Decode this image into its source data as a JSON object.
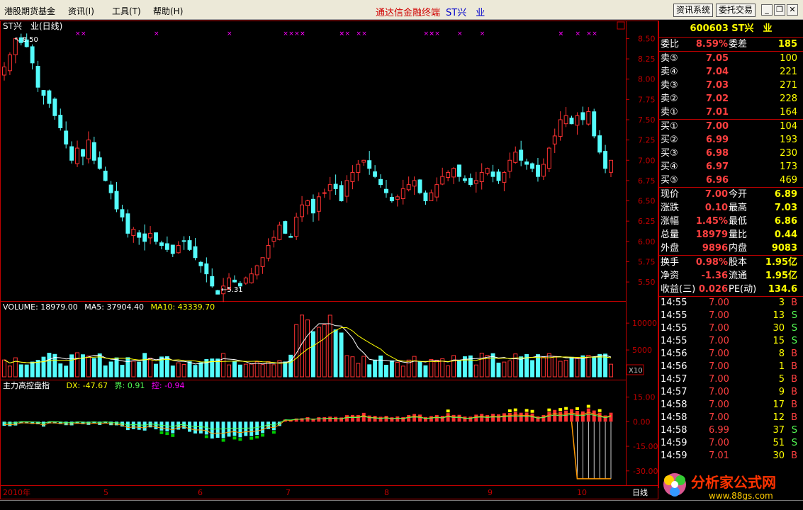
{
  "menu": {
    "items": [
      "港股期货基金",
      "资讯(I)",
      "工具(T)",
      "帮助(H)"
    ]
  },
  "title": {
    "app": "通达信金融终端",
    "stock": "ST兴　业"
  },
  "system_buttons": [
    "资讯系统",
    "委托交易"
  ],
  "chart_header": {
    "stock_label": "ST兴　业(日线)",
    "high_marker": "8.50",
    "low_marker": "5.31"
  },
  "volume_header": {
    "label": "VOLUME: 18979.00",
    "ma5": "MA5: 37904.40",
    "ma10": "MA10: 43339.70",
    "scale_btn": "X10"
  },
  "indicator_header": {
    "name": "主力高控盘指",
    "dx": "DX: -47.67",
    "jie": "界: 0.91",
    "kong": "控: -0.94"
  },
  "colors": {
    "up": "#ff3232",
    "down": "#54fcfc",
    "border": "#c00000",
    "ma_white": "#ffffff",
    "ma_yellow": "#ffff00",
    "marker_magenta": "#ff00ff"
  },
  "x_axis": {
    "labels": [
      "2010年",
      "5",
      "6",
      "7",
      "8",
      "9",
      "10"
    ],
    "period_label": "日线"
  },
  "chart_data": [
    {
      "type": "candlestick",
      "title": "ST兴　业(日线)",
      "ylim": [
        5.3,
        8.6
      ],
      "yticks": [
        "8.50",
        "8.25",
        "8.00",
        "7.75",
        "7.50",
        "7.25",
        "7.00",
        "6.75",
        "6.50",
        "6.25",
        "6.00",
        "5.75",
        "5.50"
      ],
      "closes": [
        8.15,
        8.3,
        8.5,
        8.45,
        8.4,
        8.2,
        7.9,
        7.8,
        7.7,
        7.55,
        7.4,
        7.2,
        7.0,
        7.15,
        7.05,
        7.25,
        7.0,
        6.9,
        6.75,
        6.6,
        6.4,
        6.3,
        6.1,
        6.15,
        6.05,
        6.0,
        6.1,
        6.0,
        5.95,
        5.9,
        5.85,
        5.95,
        6.0,
        5.9,
        5.8,
        5.7,
        5.6,
        5.45,
        5.35,
        5.45,
        5.55,
        5.5,
        5.45,
        5.55,
        5.6,
        5.7,
        5.8,
        5.95,
        6.05,
        6.2,
        6.1,
        6.05,
        6.3,
        6.45,
        6.5,
        6.35,
        6.55,
        6.6,
        6.7,
        6.65,
        6.5,
        6.75,
        6.85,
        6.95,
        7.0,
        6.9,
        6.8,
        6.7,
        6.6,
        6.5,
        6.55,
        6.65,
        6.7,
        6.75,
        6.6,
        6.5,
        6.6,
        6.7,
        6.8,
        6.85,
        6.9,
        6.8,
        6.75,
        6.7,
        6.75,
        6.85,
        6.9,
        6.8,
        6.75,
        6.85,
        7.0,
        7.1,
        7.0,
        6.95,
        6.9,
        6.8,
        6.95,
        7.15,
        7.3,
        7.5,
        7.55,
        7.45,
        7.55,
        7.5,
        7.6,
        7.3,
        7.1,
        6.9,
        7.0
      ],
      "volume": {
        "ylim": [
          0,
          12000
        ],
        "yticks": [
          "10000",
          "5000"
        ],
        "last_value": 18979.0,
        "ma5": 37904.4,
        "ma10": 43339.7,
        "scale": "X10"
      },
      "indicator": {
        "name": "主力高控盘指",
        "ylim": [
          -37,
          20
        ],
        "yticks": [
          "15.00",
          "0.00",
          "-15.00",
          "-30.00"
        ],
        "DX": -47.67,
        "界": 0.91,
        "控": -0.94
      }
    }
  ],
  "quote": {
    "header": "600603 ST兴　业",
    "weibi": {
      "label": "委比",
      "value": "8.59%",
      "label2": "委差",
      "value2": "185"
    },
    "sells": [
      {
        "label": "卖⑤",
        "price": "7.05",
        "vol": "100"
      },
      {
        "label": "卖④",
        "price": "7.04",
        "vol": "221"
      },
      {
        "label": "卖③",
        "price": "7.03",
        "vol": "271"
      },
      {
        "label": "卖②",
        "price": "7.02",
        "vol": "228"
      },
      {
        "label": "卖①",
        "price": "7.01",
        "vol": "164"
      }
    ],
    "buys": [
      {
        "label": "买①",
        "price": "7.00",
        "vol": "104"
      },
      {
        "label": "买②",
        "price": "6.99",
        "vol": "193"
      },
      {
        "label": "买③",
        "price": "6.98",
        "vol": "230"
      },
      {
        "label": "买④",
        "price": "6.97",
        "vol": "173"
      },
      {
        "label": "买⑤",
        "price": "6.96",
        "vol": "469"
      }
    ],
    "stats": [
      {
        "l1": "现价",
        "v1": "7.00",
        "l2": "今开",
        "v2": "6.89"
      },
      {
        "l1": "涨跌",
        "v1": "0.10",
        "l2": "最高",
        "v2": "7.03"
      },
      {
        "l1": "涨幅",
        "v1": "1.45%",
        "l2": "最低",
        "v2": "6.86"
      },
      {
        "l1": "总量",
        "v1": "18979",
        "l2": "量比",
        "v2": "0.44"
      },
      {
        "l1": "外盘",
        "v1": "9896",
        "l2": "内盘",
        "v2": "9083"
      }
    ],
    "fundamentals": [
      {
        "l1": "换手",
        "v1": "0.98%",
        "l2": "股本",
        "v2": "1.95亿"
      },
      {
        "l1": "净资",
        "v1": "-1.36",
        "l2": "流通",
        "v2": "1.95亿"
      },
      {
        "l1": "收益(三)",
        "v1": "0.026",
        "l2": "PE(动)",
        "v2": "134.6"
      }
    ],
    "ticks": [
      {
        "time": "14:55",
        "price": "7.00",
        "vol": "3",
        "flag": "B"
      },
      {
        "time": "14:55",
        "price": "7.00",
        "vol": "13",
        "flag": "S"
      },
      {
        "time": "14:55",
        "price": "7.00",
        "vol": "30",
        "flag": "S"
      },
      {
        "time": "14:55",
        "price": "7.00",
        "vol": "15",
        "flag": "S"
      },
      {
        "time": "14:56",
        "price": "7.00",
        "vol": "8",
        "flag": "B"
      },
      {
        "time": "14:56",
        "price": "7.00",
        "vol": "1",
        "flag": "B"
      },
      {
        "time": "14:57",
        "price": "7.00",
        "vol": "5",
        "flag": "B"
      },
      {
        "time": "14:57",
        "price": "7.00",
        "vol": "9",
        "flag": "B"
      },
      {
        "time": "14:58",
        "price": "7.00",
        "vol": "17",
        "flag": "B"
      },
      {
        "time": "14:58",
        "price": "7.00",
        "vol": "12",
        "flag": "B"
      },
      {
        "time": "14:58",
        "price": "6.99",
        "vol": "37",
        "flag": "S"
      },
      {
        "time": "14:59",
        "price": "7.00",
        "vol": "51",
        "flag": "S"
      },
      {
        "time": "14:59",
        "price": "7.01",
        "vol": "30",
        "flag": "B"
      }
    ]
  },
  "watermark": {
    "name": "分析家公式网",
    "url": "www.88gs.com"
  }
}
